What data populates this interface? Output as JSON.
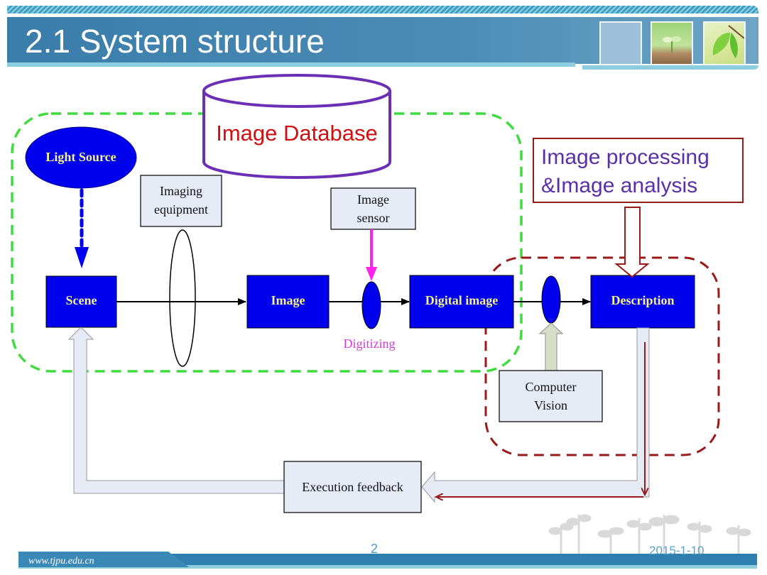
{
  "slide": {
    "title": "2.1 System structure",
    "page_number": "2",
    "date": "2015-1-10",
    "footer_url": "www.tjpu.edu.cn"
  },
  "diagram": {
    "database_label": "Image Database",
    "processing_label_line1": "Image processing",
    "processing_label_line2": "&Image analysis",
    "light_source": "Light Source",
    "imaging_equipment_line1": "Imaging",
    "imaging_equipment_line2": "equipment",
    "image_sensor_line1": "Image",
    "image_sensor_line2": "sensor",
    "scene": "Scene",
    "image": "Image",
    "digital_image": "Digital image",
    "description": "Description",
    "digitizing": "Digitizing",
    "computer_vision_line1": "Computer",
    "computer_vision_line2": "Vision",
    "execution_feedback": "Execution feedback"
  },
  "colors": {
    "node_blue": "#0000ee",
    "node_text": "#f5f08e",
    "database_outline": "#6a2fb4",
    "database_text": "#d01010",
    "processing_text": "#5a2fa8",
    "processing_border": "#9a1a1a",
    "green_region": "#3fdc3f",
    "red_region": "#9a1a1a",
    "digitizing_text": "#d43bd4",
    "sensor_arrow": "#ff22ee",
    "light_box_fill": "#e6ebf5"
  }
}
